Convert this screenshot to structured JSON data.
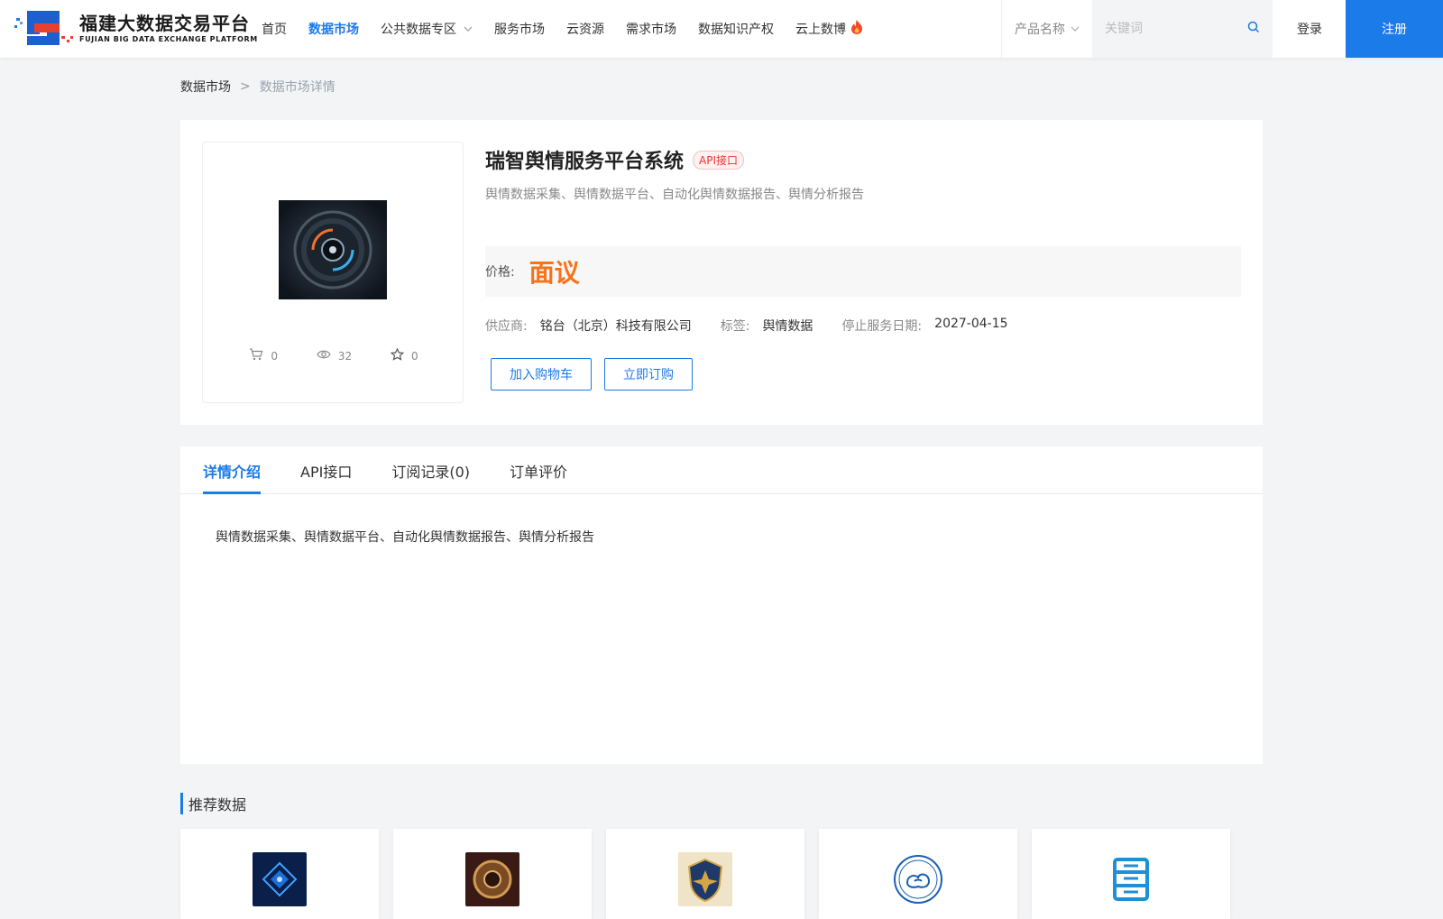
{
  "header": {
    "logo_cn": "福建大数据交易平台",
    "logo_en": "FUJIAN BIG DATA EXCHANGE  PLATFORM",
    "nav": [
      {
        "label": "首页",
        "active": false
      },
      {
        "label": "数据市场",
        "active": true
      },
      {
        "label": "公共数据专区",
        "active": false,
        "dropdown": true
      },
      {
        "label": "服务市场",
        "active": false
      },
      {
        "label": "云资源",
        "active": false
      },
      {
        "label": "需求市场",
        "active": false
      },
      {
        "label": "数据知识产权",
        "active": false
      },
      {
        "label": "云上数博",
        "active": false,
        "hot": true
      }
    ],
    "search_select": "产品名称",
    "search_placeholder": "关键词",
    "login": "登录",
    "register": "注册"
  },
  "breadcrumb": {
    "first": "数据市场",
    "separator": ">",
    "current": "数据市场详情"
  },
  "product": {
    "title": "瑞智舆情服务平台系统",
    "badge": "API接口",
    "subtitle": "舆情数据采集、舆情数据平台、自动化舆情数据报告、舆情分析报告",
    "price_label": "价格:",
    "price_value": "面议",
    "supplier_label": "供应商:",
    "supplier": "铭台（北京）科技有限公司",
    "tag_label": "标签:",
    "tag": "舆情数据",
    "stop_label": "停止服务日期:",
    "stop_date": "2027-04-15",
    "stats": {
      "cart": "0",
      "views": "32",
      "favorites": "0"
    },
    "add_cart": "加入购物车",
    "buy_now": "立即订购"
  },
  "tabs": [
    "详情介绍",
    "API接口",
    "订阅记录(0)",
    "订单评价"
  ],
  "detail_text": "舆情数据采集、舆情数据平台、自动化舆情数据报告、舆情分析报告",
  "recommend": {
    "title": "推荐数据",
    "items": [
      {
        "icon": "blue-tech-icon"
      },
      {
        "icon": "bronze-emblem-icon"
      },
      {
        "icon": "shield-emblem-icon"
      },
      {
        "icon": "weather-bureau-logo-icon"
      },
      {
        "icon": "server-icon"
      }
    ]
  },
  "colors": {
    "primary": "#1b7be8",
    "price": "#f6731a",
    "badge_red": "#e33"
  }
}
